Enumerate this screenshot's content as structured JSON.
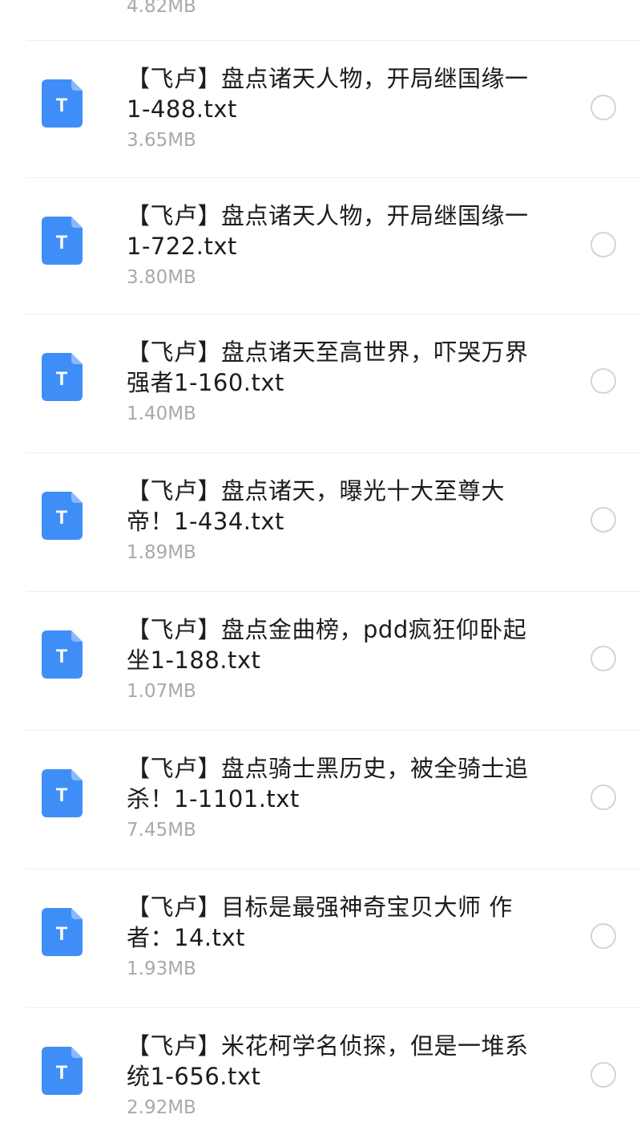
{
  "top_partial": {
    "size": "4.82MB"
  },
  "colors": {
    "icon_bg": "#3f8ef7",
    "divider": "#efeff1",
    "radio_border": "#d4d4d8",
    "size_text": "#a9a9ad"
  },
  "icon": {
    "name": "txt-file-icon",
    "glyph": "T"
  },
  "files": [
    {
      "line1": "【飞卢】盘点诸天人物，开局继国缘一",
      "line2": "1-488.txt",
      "size": "3.65MB"
    },
    {
      "line1": "【飞卢】盘点诸天人物，开局继国缘一",
      "line2": "1-722.txt",
      "size": "3.80MB"
    },
    {
      "line1": "【飞卢】盘点诸天至高世界，吓哭万界",
      "line2": "强者1-160.txt",
      "size": "1.40MB"
    },
    {
      "line1": "【飞卢】盘点诸天，曝光十大至尊大",
      "line2": "帝！1-434.txt",
      "size": "1.89MB"
    },
    {
      "line1": "【飞卢】盘点金曲榜，pdd疯狂仰卧起",
      "line2": "坐1-188.txt",
      "size": "1.07MB"
    },
    {
      "line1": "【飞卢】盘点骑士黑历史，被全骑士追",
      "line2": "杀！1-1101.txt",
      "size": "7.45MB"
    },
    {
      "line1": "【飞卢】目标是最强神奇宝贝大师 作",
      "line2": "者：14.txt",
      "size": "1.93MB"
    },
    {
      "line1": "【飞卢】米花柯学名侦探，但是一堆系",
      "line2": "统1-656.txt",
      "size": "2.92MB"
    }
  ]
}
